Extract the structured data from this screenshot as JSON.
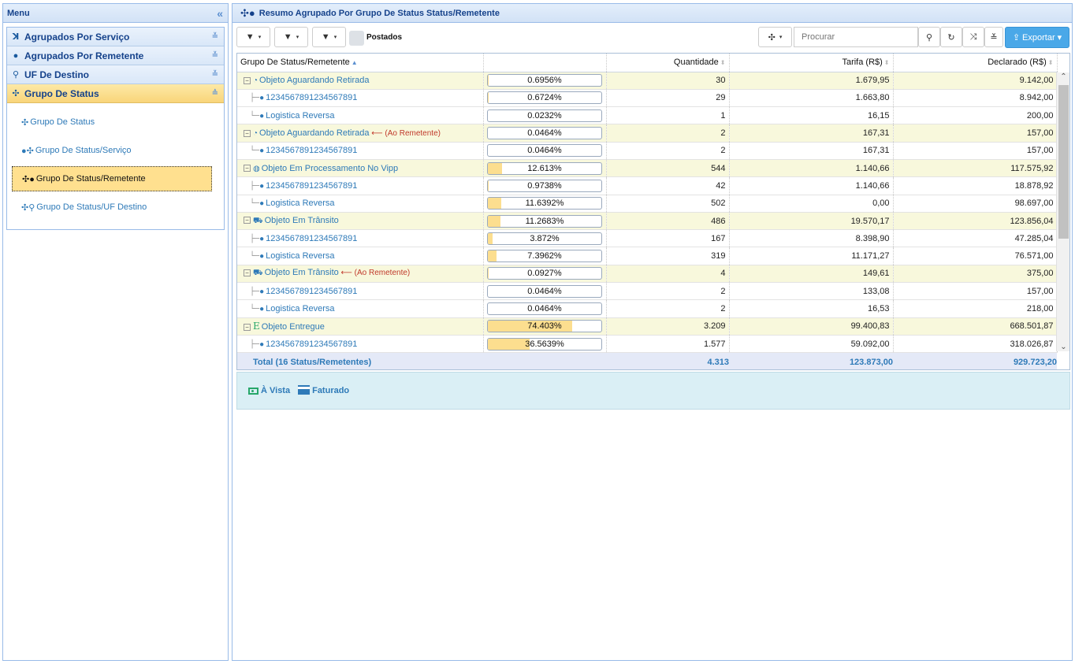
{
  "menu": {
    "title": "Menu",
    "collapse": "«",
    "sections": [
      {
        "label": "Agrupados Por Serviço",
        "icon": "ꓘ",
        "icon_name": "service-icon",
        "toggle": "≚"
      },
      {
        "label": "Agrupados Por Remetente",
        "icon": "●",
        "icon_name": "user-icon",
        "toggle": "≚"
      },
      {
        "label": "UF De Destino",
        "icon": "⚲",
        "icon_name": "map-marker-icon",
        "toggle": "≚"
      },
      {
        "label": "Grupo De Status",
        "icon": "✣",
        "icon_name": "arrows-icon",
        "toggle": "≙",
        "active": true
      }
    ],
    "items": [
      {
        "label": "Grupo De Status",
        "icon": "✣"
      },
      {
        "label": "Grupo De Status/Serviço",
        "icon": "●✣"
      },
      {
        "label": "Grupo De Status/Remetente",
        "icon": "✣●",
        "selected": true
      },
      {
        "label": "Grupo De Status/UF Destino",
        "icon": "✣⚲"
      }
    ]
  },
  "main": {
    "title": "Resumo Agrupado Por Grupo De Status Status/Remetente",
    "title_icon": "✣●"
  },
  "toolbar": {
    "filter_icon": "▼",
    "caret": "▾",
    "checkbox_label": "Postados",
    "move_icon": "✣",
    "search_placeholder": "Procurar",
    "search_icon": "⚲",
    "refresh_icon": "↻",
    "shuffle_icon": "⤨",
    "expand_icon": "≚",
    "export_label": "Exportar",
    "export_icon": "⇪"
  },
  "grid": {
    "columns": [
      "Grupo De Status/Remetente",
      "",
      "Quantidade",
      "Tarifa (R$)",
      "Declarado (R$)"
    ],
    "rows": [
      {
        "level": 0,
        "name": "Objeto Aguardando Retirada",
        "icon": "◔",
        "pct": "0.6956%",
        "pct_value": 0.6956,
        "qty": "30",
        "tarifa": "1.679,95",
        "declarado": "9.142,00"
      },
      {
        "level": 1,
        "name": "1234567891234567891",
        "icon": "●",
        "pct": "0.6724%",
        "pct_value": 0.6724,
        "qty": "29",
        "tarifa": "1.663,80",
        "declarado": "8.942,00"
      },
      {
        "level": 1,
        "last": true,
        "name": "Logistica Reversa",
        "icon": "●",
        "pct": "0.0232%",
        "pct_value": 0.0232,
        "qty": "1",
        "tarifa": "16,15",
        "declarado": "200,00"
      },
      {
        "level": 0,
        "name": "Objeto Aguardando Retirada",
        "icon": "◔",
        "remetente": "(Ao Remetente)",
        "pct": "0.0464%",
        "pct_value": 0.0464,
        "qty": "2",
        "tarifa": "167,31",
        "declarado": "157,00"
      },
      {
        "level": 1,
        "last": true,
        "name": "1234567891234567891",
        "icon": "●",
        "pct": "0.0464%",
        "pct_value": 0.0464,
        "qty": "2",
        "tarifa": "167,31",
        "declarado": "157,00"
      },
      {
        "level": 0,
        "name": "Objeto Em Processamento No Vipp",
        "icon": "◍",
        "pct": "12.613%",
        "pct_value": 12.613,
        "qty": "544",
        "tarifa": "1.140,66",
        "declarado": "117.575,92"
      },
      {
        "level": 1,
        "name": "1234567891234567891",
        "icon": "●",
        "pct": "0.9738%",
        "pct_value": 0.9738,
        "qty": "42",
        "tarifa": "1.140,66",
        "declarado": "18.878,92"
      },
      {
        "level": 1,
        "last": true,
        "name": "Logistica Reversa",
        "icon": "●",
        "pct": "11.6392%",
        "pct_value": 11.6392,
        "qty": "502",
        "tarifa": "0,00",
        "declarado": "98.697,00"
      },
      {
        "level": 0,
        "name": "Objeto Em Trânsito",
        "icon": "⛟",
        "pct": "11.2683%",
        "pct_value": 11.2683,
        "qty": "486",
        "tarifa": "19.570,17",
        "declarado": "123.856,04"
      },
      {
        "level": 1,
        "name": "1234567891234567891",
        "icon": "●",
        "pct": "3.872%",
        "pct_value": 3.872,
        "qty": "167",
        "tarifa": "8.398,90",
        "declarado": "47.285,04"
      },
      {
        "level": 1,
        "last": true,
        "name": "Logistica Reversa",
        "icon": "●",
        "pct": "7.3962%",
        "pct_value": 7.3962,
        "qty": "319",
        "tarifa": "11.171,27",
        "declarado": "76.571,00"
      },
      {
        "level": 0,
        "name": "Objeto Em Trânsito",
        "icon": "⛟",
        "remetente": "(Ao Remetente)",
        "pct": "0.0927%",
        "pct_value": 0.0927,
        "qty": "4",
        "tarifa": "149,61",
        "declarado": "375,00"
      },
      {
        "level": 1,
        "name": "1234567891234567891",
        "icon": "●",
        "pct": "0.0464%",
        "pct_value": 0.0464,
        "qty": "2",
        "tarifa": "133,08",
        "declarado": "157,00"
      },
      {
        "level": 1,
        "last": true,
        "name": "Logistica Reversa",
        "icon": "●",
        "pct": "0.0464%",
        "pct_value": 0.0464,
        "qty": "2",
        "tarifa": "16,53",
        "declarado": "218,00"
      },
      {
        "level": 0,
        "name": "Objeto Entregue",
        "icon": "E",
        "icon_color": "#27a76a",
        "pct": "74.403%",
        "pct_value": 74.403,
        "qty": "3.209",
        "tarifa": "99.400,83",
        "declarado": "668.501,87"
      },
      {
        "level": 1,
        "name": "1234567891234567891",
        "icon": "●",
        "pct": "36.5639%",
        "pct_value": 36.5639,
        "qty": "1.577",
        "tarifa": "59.092,00",
        "declarado": "318.026,87"
      }
    ],
    "total": {
      "label": "Total (16 Status/Remetentes)",
      "qty": "4.313",
      "tarifa": "123.873,00",
      "declarado": "929.723,20"
    }
  },
  "legend": {
    "items": [
      {
        "label": "À Vista",
        "icon": "cash-icon"
      },
      {
        "label": "Faturado",
        "icon": "credit-card-icon"
      }
    ]
  },
  "colors": {
    "accent": "#2e7ab8",
    "bar_fill": "#fcde8f",
    "group_row": "#f8f8dc",
    "selected": "#ffe08f",
    "export": "#4aa8e8"
  }
}
